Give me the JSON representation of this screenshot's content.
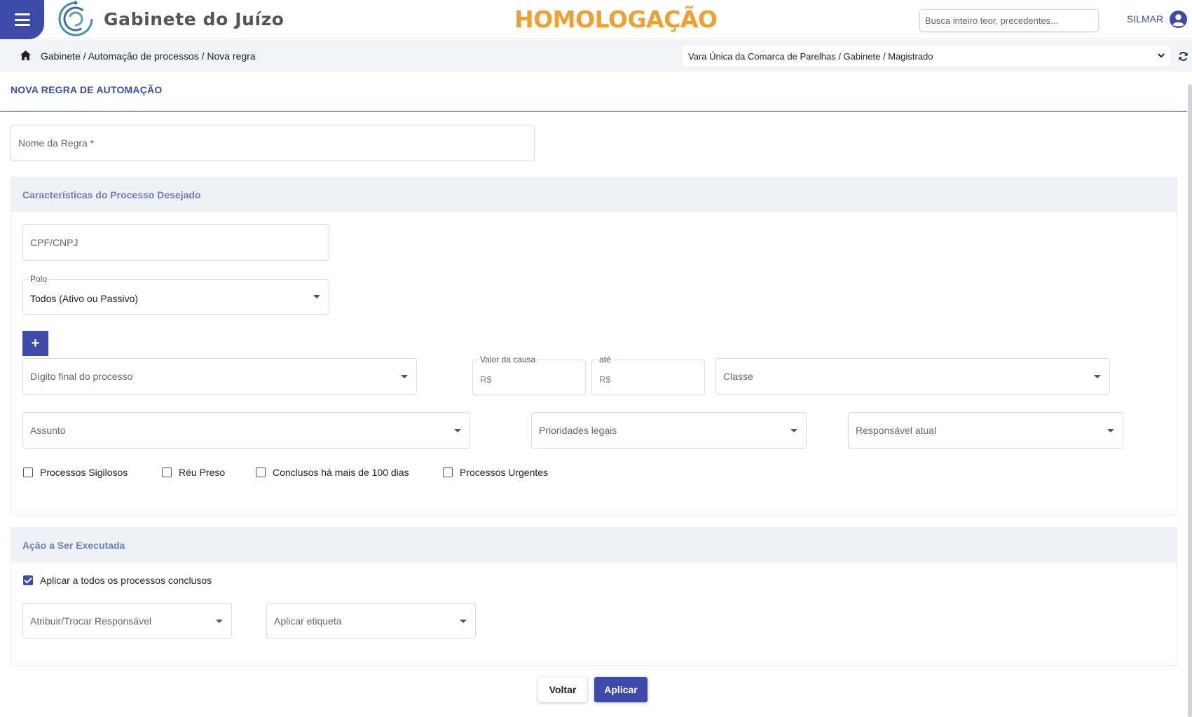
{
  "header": {
    "app_title": "Gabinete do Juízo",
    "environment": "HOMOLOGAÇÃO",
    "search_placeholder": "Busca inteiro teor, precedentes...",
    "user": "SILMAR"
  },
  "breadcrumb": {
    "path": "Gabinete / Automação de processos / Nova regra",
    "unit": "Vara Única da Comarca de Parelhas / Gabinete / Magistrado"
  },
  "page": {
    "title": "NOVA REGRA DE AUTOMAÇÃO",
    "rule_name_placeholder": "Nome da Regra *"
  },
  "process_section": {
    "title": "Características do Processo Desejado",
    "cpf_placeholder": "CPF/CNPJ",
    "polo_label": "Polo",
    "polo_value": "Todos (Ativo ou Passivo)",
    "add_label": "+",
    "digit_placeholder": "Dígito final do processo",
    "value_label": "Valor da causa",
    "value_prefix": "R$",
    "until_label": "até",
    "until_prefix": "R$",
    "class_placeholder": "Classe",
    "subject_placeholder": "Assunto",
    "priority_placeholder": "Prioridades legais",
    "responsible_placeholder": "Responsável atual",
    "checkboxes": [
      {
        "label": "Processos Sigilosos",
        "checked": false
      },
      {
        "label": "Réu Preso",
        "checked": false
      },
      {
        "label": "Conclusos há mais de 100 dias",
        "checked": false
      },
      {
        "label": "Processos Urgentes",
        "checked": false
      }
    ]
  },
  "action_section": {
    "title": "Ação a Ser Executada",
    "apply_all_label": "Aplicar a todos os processos conclusos",
    "apply_all_checked": true,
    "assign_placeholder": "Atribuir/Trocar Responsável",
    "tag_placeholder": "Aplicar etiqueta"
  },
  "buttons": {
    "back": "Voltar",
    "apply": "Aplicar"
  },
  "colors": {
    "primary": "#3d4aa8",
    "environment": "#f0a030",
    "section_title": "#6b7fb8"
  }
}
